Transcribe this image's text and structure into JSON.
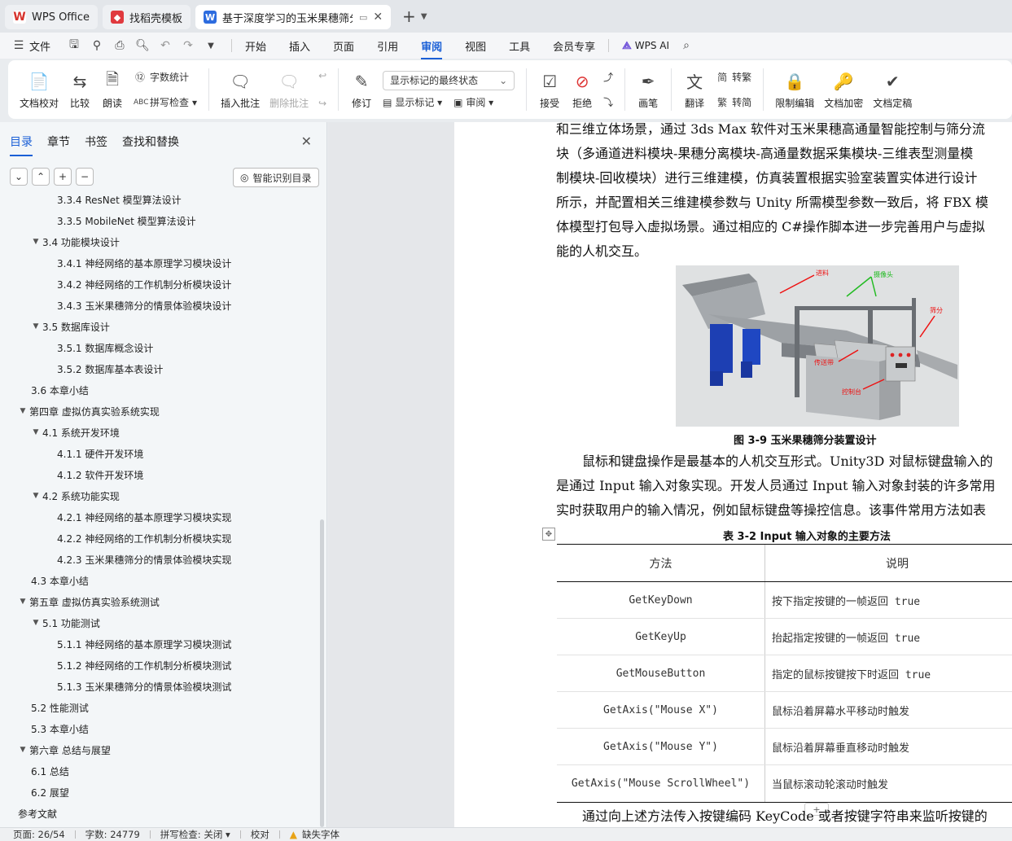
{
  "tabs": [
    {
      "label": "WPS Office",
      "icon": "wps-logo-icon",
      "color": "#d6322c",
      "active": false
    },
    {
      "label": "找稻壳模板",
      "icon": "docer-icon",
      "color": "#e0393e",
      "active": false
    },
    {
      "label": "基于深度学习的玉米果穗筛分",
      "icon": "word-doc-icon",
      "color": "#2d6cdf",
      "active": true
    }
  ],
  "menu": {
    "file": "文件",
    "items": [
      "开始",
      "插入",
      "页面",
      "引用",
      "审阅",
      "视图",
      "工具",
      "会员专享"
    ],
    "active": "审阅",
    "ai": "WPS AI"
  },
  "ribbon": {
    "proofread": "文档校对",
    "compare": "比较",
    "read_aloud": "朗读",
    "word_count": "字数统计",
    "spell_check": "拼写检查",
    "insert_comment": "插入批注",
    "delete_comment": "删除批注",
    "revise": "修订",
    "markup_state": "显示标记的最终状态",
    "show_markup": "显示标记",
    "review_pane": "审阅",
    "accept": "接受",
    "reject": "拒绝",
    "pen": "画笔",
    "translate": "翻译",
    "to_traditional": "转繁",
    "to_simplified": "转简",
    "restrict_edit": "限制编辑",
    "encrypt": "文档加密",
    "finalize": "文档定稿"
  },
  "nav": {
    "tabs": [
      "目录",
      "章节",
      "书签",
      "查找和替换"
    ],
    "active": "目录",
    "smart_toc": "智能识别目录"
  },
  "toc": [
    {
      "text": "3.3.4 ResNet 模型算法设计",
      "level": 3,
      "arrow": ""
    },
    {
      "text": "3.3.5 MobileNet 模型算法设计",
      "level": 3,
      "arrow": ""
    },
    {
      "text": "3.4 功能模块设计",
      "level": 2,
      "arrow": "▼"
    },
    {
      "text": "3.4.1 神经网络的基本原理学习模块设计",
      "level": 3,
      "arrow": ""
    },
    {
      "text": "3.4.2 神经网络的工作机制分析模块设计",
      "level": 3,
      "arrow": ""
    },
    {
      "text": "3.4.3 玉米果穗筛分的情景体验模块设计",
      "level": 3,
      "arrow": ""
    },
    {
      "text": "3.5 数据库设计",
      "level": 2,
      "arrow": "▼"
    },
    {
      "text": "3.5.1 数据库概念设计",
      "level": 3,
      "arrow": ""
    },
    {
      "text": "3.5.2 数据库基本表设计",
      "level": 3,
      "arrow": ""
    },
    {
      "text": "3.6 本章小结",
      "level": 2,
      "arrow": ""
    },
    {
      "text": "第四章 虚拟仿真实验系统实现",
      "level": 1,
      "arrow": "▼"
    },
    {
      "text": "4.1 系统开发环境",
      "level": 2,
      "arrow": "▼"
    },
    {
      "text": "4.1.1 硬件开发环境",
      "level": 3,
      "arrow": ""
    },
    {
      "text": "4.1.2 软件开发环境",
      "level": 3,
      "arrow": ""
    },
    {
      "text": "4.2 系统功能实现",
      "level": 2,
      "arrow": "▼"
    },
    {
      "text": "4.2.1 神经网络的基本原理学习模块实现",
      "level": 3,
      "arrow": ""
    },
    {
      "text": "4.2.2 神经网络的工作机制分析模块实现",
      "level": 3,
      "arrow": ""
    },
    {
      "text": "4.2.3 玉米果穗筛分的情景体验模块实现",
      "level": 3,
      "arrow": ""
    },
    {
      "text": "4.3 本章小结",
      "level": 2,
      "arrow": ""
    },
    {
      "text": "第五章 虚拟仿真实验系统测试",
      "level": 1,
      "arrow": "▼"
    },
    {
      "text": "5.1 功能测试",
      "level": 2,
      "arrow": "▼"
    },
    {
      "text": "5.1.1 神经网络的基本原理学习模块测试",
      "level": 3,
      "arrow": ""
    },
    {
      "text": "5.1.2 神经网络的工作机制分析模块测试",
      "level": 3,
      "arrow": ""
    },
    {
      "text": "5.1.3 玉米果穗筛分的情景体验模块测试",
      "level": 3,
      "arrow": ""
    },
    {
      "text": "5.2 性能测试",
      "level": 2,
      "arrow": ""
    },
    {
      "text": "5.3 本章小结",
      "level": 2,
      "arrow": ""
    },
    {
      "text": "第六章 总结与展望",
      "level": 1,
      "arrow": "▼"
    },
    {
      "text": "6.1 总结",
      "level": 2,
      "arrow": ""
    },
    {
      "text": "6.2 展望",
      "level": 2,
      "arrow": ""
    },
    {
      "text": "参考文献",
      "level": 1,
      "arrow": ""
    }
  ],
  "doc": {
    "para1": [
      "和三维立体场景，通过 3ds Max 软件对玉米果穗高通量智能控制与筛分流",
      "块（多通道进料模块-果穗分离模块-高通量数据采集模块-三维表型测量模",
      "制模块-回收模块）进行三维建模，仿真装置根据实验室装置实体进行设计",
      "所示，并配置相关三维建模参数与 Unity 所需模型参数一致后，将 FBX 模",
      "体模型打包导入虚拟场景。通过相应的 C#操作脚本进一步完善用户与虚拟",
      "能的人机交互。"
    ],
    "figure_labels": {
      "feed": "进料",
      "camera": "摄像头",
      "sieve": "筛分",
      "belt": "传送带",
      "console": "控制台"
    },
    "figure_caption": "图 3-9 玉米果穗筛分装置设计",
    "para2": [
      "　　鼠标和键盘操作是最基本的人机交互形式。Unity3D 对鼠标键盘输入的",
      "是通过 Input 输入对象实现。开发人员通过 Input 输入对象封装的许多常用",
      "实时获取用户的输入情况，例如鼠标键盘等操控信息。该事件常用方法如表"
    ],
    "table_caption": "表 3-2 Input 输入对象的主要方法",
    "table_head": [
      "方法",
      "说明"
    ],
    "table_rows": [
      [
        "GetKeyDown",
        "按下指定按键的一帧返回 true"
      ],
      [
        "GetKeyUp",
        "抬起指定按键的一帧返回 true"
      ],
      [
        "GetMouseButton",
        "指定的鼠标按键按下时返回 true"
      ],
      [
        "GetAxis(\"Mouse X\")",
        "鼠标沿着屏幕水平移动时触发"
      ],
      [
        "GetAxis(\"Mouse Y\")",
        "鼠标沿着屏幕垂直移动时触发"
      ],
      [
        "GetAxis(\"Mouse ScrollWheel\")",
        "当鼠标滚动轮滚动时触发"
      ]
    ],
    "para3": "　　通过向上述方法传入按键编码 KeyCode 或者按键字符串来监听按键的"
  },
  "status": {
    "page": "页面: 26/54",
    "words": "字数: 24779",
    "spell": "拼写检查: 关闭",
    "proof": "校对",
    "missing_font": "缺失字体"
  }
}
